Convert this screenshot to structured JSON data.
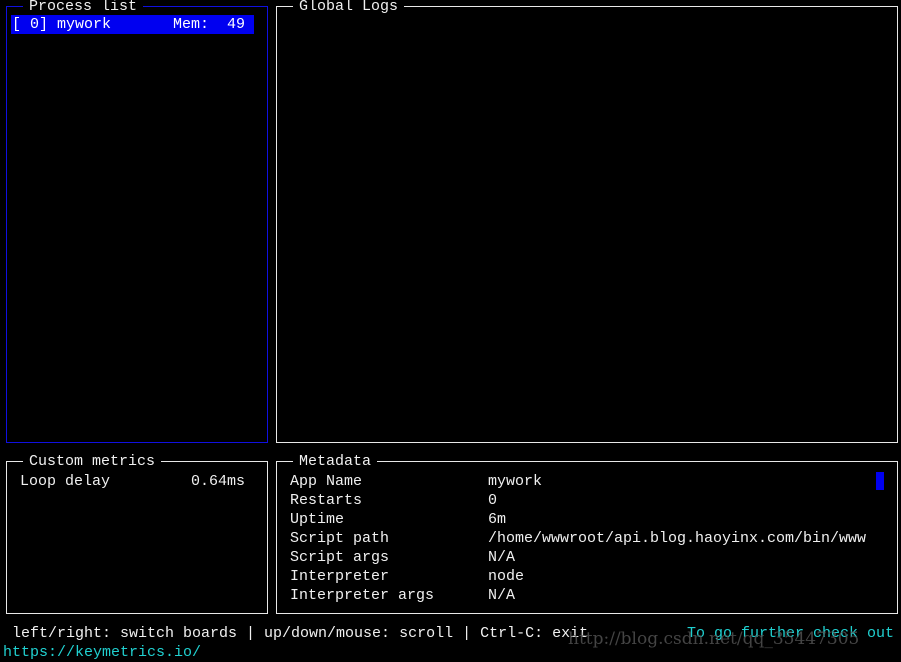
{
  "process_list": {
    "title": "Process list",
    "items": [
      {
        "label": "[ 0] mywork",
        "mem_label": "Mem:",
        "mem_value": "49"
      }
    ]
  },
  "global_logs": {
    "title": "Global Logs"
  },
  "custom_metrics": {
    "title": "Custom metrics",
    "rows": [
      {
        "label": "Loop delay",
        "value": "0.64ms"
      }
    ]
  },
  "metadata": {
    "title": "Metadata",
    "rows": [
      {
        "key": "App Name",
        "value": "mywork"
      },
      {
        "key": "Restarts",
        "value": "0"
      },
      {
        "key": "Uptime",
        "value": "6m"
      },
      {
        "key": "Script path",
        "value": "/home/wwwroot/api.blog.haoyinx.com/bin/www"
      },
      {
        "key": "Script args",
        "value": "N/A"
      },
      {
        "key": "Interpreter",
        "value": "node"
      },
      {
        "key": "Interpreter args",
        "value": "N/A"
      }
    ]
  },
  "footer": {
    "help": "left/right: switch boards | up/down/mouse: scroll | Ctrl-C: exit",
    "further": "To go further check out",
    "link": "https://keymetrics.io/"
  },
  "watermark": "http://blog.csdn.net/qq_35447305",
  "colors": {
    "selection": "#0000f0",
    "accent": "#20d0d0",
    "focus_border": "#1010e0"
  }
}
